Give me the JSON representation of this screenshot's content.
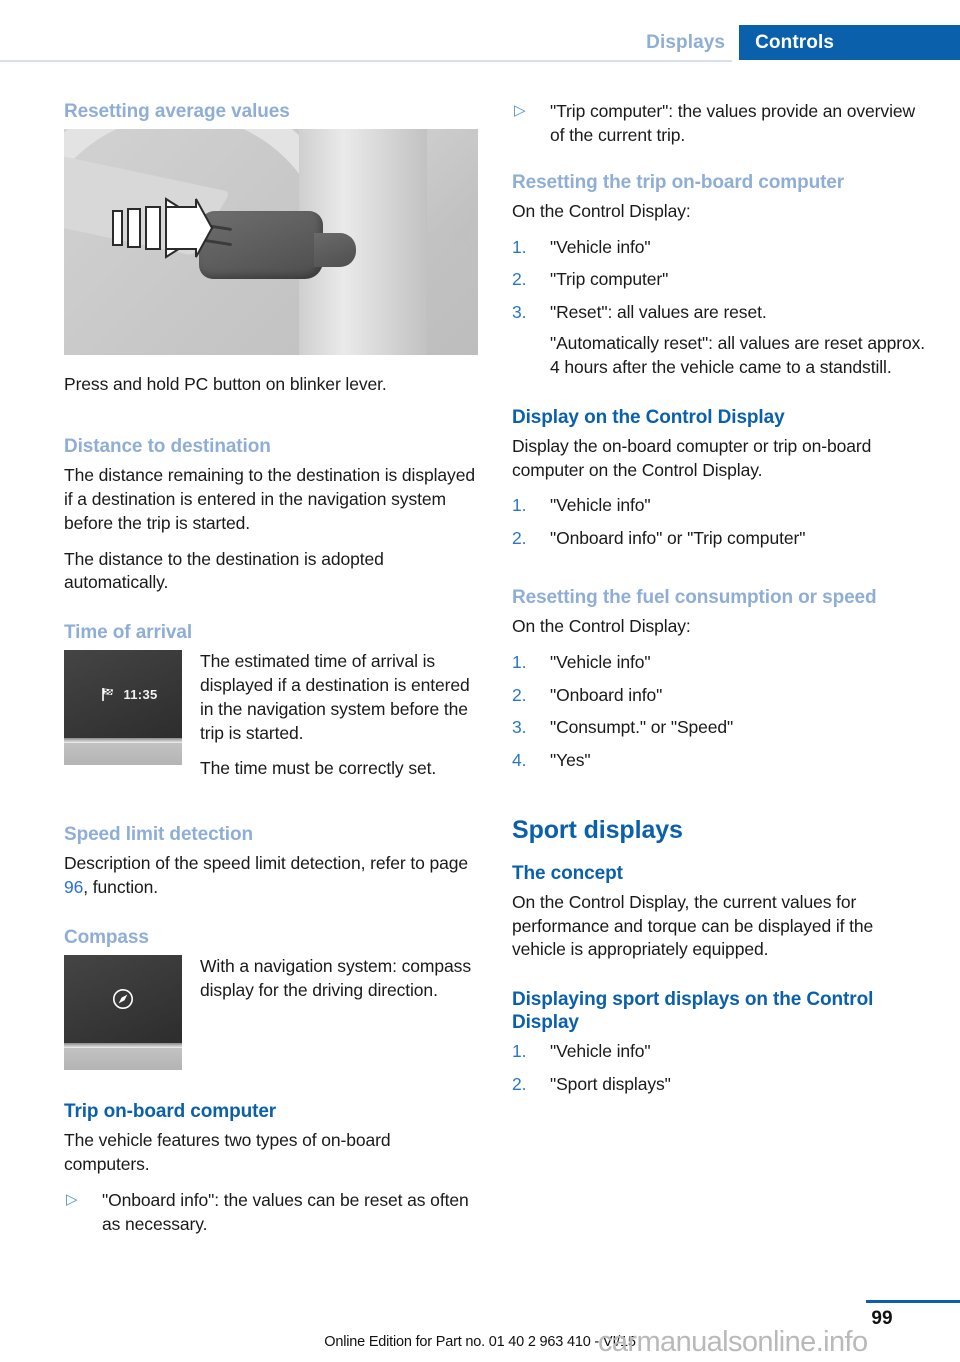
{
  "header": {
    "tab_inactive": "Displays",
    "tab_active": "Controls",
    "accent_blue": "#0b60ab",
    "light_blue": "#8faed6"
  },
  "left_column": {
    "resetting_average_values": {
      "heading": "Resetting average values",
      "illustration_name": "blinker-lever-pc-button",
      "caption": "Press and hold PC button on blinker lever."
    },
    "distance_to_destination": {
      "heading": "Distance to destination",
      "paragraph1": "The distance remaining to the destination is displayed if a destination is entered in the navigation system before the trip is started.",
      "paragraph2": "The distance to the destination is adopted automatically."
    },
    "time_of_arrival": {
      "heading": "Time of arrival",
      "display_icon": "checkered-flag-icon",
      "display_value": "11:35",
      "paragraph1": "The estimated time of arrival is displayed if a destination is entered in the navigation system before the trip is started.",
      "paragraph2": "The time must be correctly set."
    },
    "speed_limit_detection": {
      "heading": "Speed limit detection",
      "text_before": "Description of the speed limit detection, refer to page ",
      "page_link": "96",
      "text_after": ", function."
    },
    "compass": {
      "heading": "Compass",
      "display_icon": "compass-icon",
      "paragraph1": "With a navigation system: compass display for the driving direction."
    },
    "trip_onboard_computer": {
      "heading": "Trip on-board computer",
      "paragraph1": "The vehicle features two types of on-board computers.",
      "bullets": [
        "\"Onboard info\": the values can be reset as often as necessary."
      ]
    }
  },
  "right_column": {
    "continued_bullets": [
      "\"Trip computer\": the values provide an overview of the current trip."
    ],
    "resetting_trip_onboard_computer": {
      "heading": "Resetting the trip on-board computer",
      "intro": "On the Control Display:",
      "steps": [
        "\"Vehicle info\"",
        "\"Trip computer\"",
        "\"Reset\": all values are reset."
      ],
      "sub_paragraph": "\"Automatically reset\": all values are reset approx. 4 hours after the vehicle came to a standstill."
    },
    "display_on_control_display": {
      "heading": "Display on the Control Display",
      "paragraph1": "Display the on-board comupter or trip on-board computer on the Control Display.",
      "steps": [
        "\"Vehicle info\"",
        "\"Onboard info\" or \"Trip computer\""
      ]
    },
    "resetting_fuel_consumption_or_speed": {
      "heading": "Resetting the fuel consumption or speed",
      "intro": "On the Control Display:",
      "steps": [
        "\"Vehicle info\"",
        "\"Onboard info\"",
        "\"Consumpt.\" or \"Speed\"",
        "\"Yes\""
      ]
    },
    "sport_displays": {
      "heading": "Sport displays",
      "concept_heading": "The concept",
      "concept_paragraph": "On the Control Display, the current values for performance and torque can be displayed if the vehicle is appropriately equipped.",
      "displaying_heading": "Displaying sport displays on the Control Display",
      "steps": [
        "\"Vehicle info\"",
        "\"Sport displays\""
      ]
    }
  },
  "footer": {
    "edition_line": "Online Edition for Part no. 01 40 2 963 410 - VI/15",
    "page_number": "99",
    "watermark": "carmanualsonline.info"
  },
  "list_markers": {
    "num1": "1.",
    "num2": "2.",
    "num3": "3.",
    "num4": "4.",
    "triangle": "▷"
  }
}
